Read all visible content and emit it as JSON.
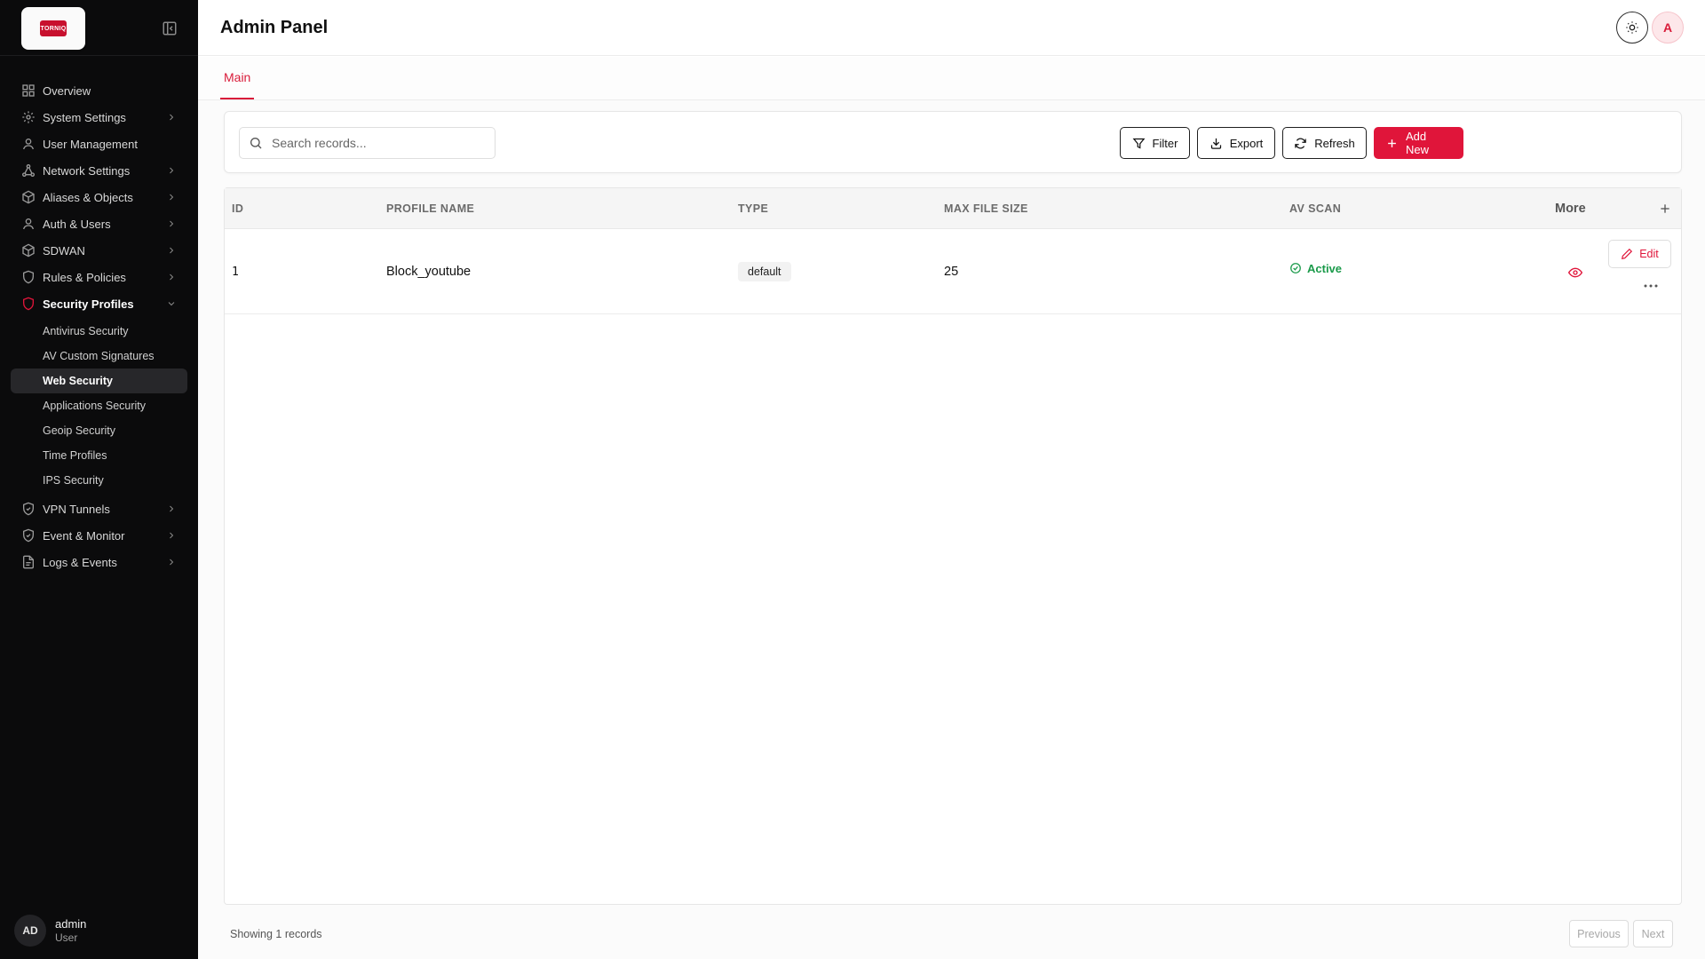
{
  "brand": {
    "logo_text": "TORNIQ"
  },
  "header": {
    "title": "Admin Panel",
    "user_initial": "A"
  },
  "sidebar": {
    "items": [
      {
        "label": "Overview",
        "icon": "grid-icon",
        "has_chevron": false
      },
      {
        "label": "System Settings",
        "icon": "gear-icon",
        "has_chevron": true
      },
      {
        "label": "User Management",
        "icon": "user-icon",
        "has_chevron": false
      },
      {
        "label": "Network Settings",
        "icon": "network-icon",
        "has_chevron": true
      },
      {
        "label": "Aliases & Objects",
        "icon": "cube-icon",
        "has_chevron": true
      },
      {
        "label": "Auth & Users",
        "icon": "user-icon",
        "has_chevron": true
      },
      {
        "label": "SDWAN",
        "icon": "cube-icon",
        "has_chevron": true
      },
      {
        "label": "Rules & Policies",
        "icon": "shield-icon",
        "has_chevron": true
      },
      {
        "label": "Security Profiles",
        "icon": "shield-icon",
        "has_chevron": true,
        "expanded": true
      },
      {
        "label": "VPN Tunnels",
        "icon": "shield-check-icon",
        "has_chevron": true
      },
      {
        "label": "Event & Monitor",
        "icon": "shield-check-icon",
        "has_chevron": true
      },
      {
        "label": "Logs & Events",
        "icon": "file-icon",
        "has_chevron": true
      }
    ],
    "sub_items": [
      {
        "label": "Antivirus Security"
      },
      {
        "label": "AV Custom Signatures"
      },
      {
        "label": "Web Security",
        "selected": true
      },
      {
        "label": "Applications Security"
      },
      {
        "label": "Geoip Security"
      },
      {
        "label": "Time Profiles"
      },
      {
        "label": "IPS Security"
      }
    ],
    "user": {
      "initials": "AD",
      "name": "admin",
      "role": "User"
    }
  },
  "tabs": [
    {
      "label": "Main",
      "active": true
    }
  ],
  "toolbar": {
    "search_placeholder": "Search records...",
    "filter_label": "Filter",
    "export_label": "Export",
    "refresh_label": "Refresh",
    "add_label": "Add New"
  },
  "table": {
    "columns": [
      "ID",
      "PROFILE NAME",
      "TYPE",
      "MAX FILE SIZE",
      "AV SCAN",
      "More"
    ],
    "rows": [
      {
        "id": "1",
        "profile_name": "Block_youtube",
        "type": "default",
        "max_file_size": "25",
        "av_scan": "Active",
        "edit_label": "Edit"
      }
    ]
  },
  "footer": {
    "count_text": "Showing 1 records",
    "prev_label": "Previous",
    "next_label": "Next"
  },
  "colors": {
    "accent": "#e0153a",
    "sidebar_bg": "#0b0b0c",
    "status_green": "#1a9a4a"
  }
}
